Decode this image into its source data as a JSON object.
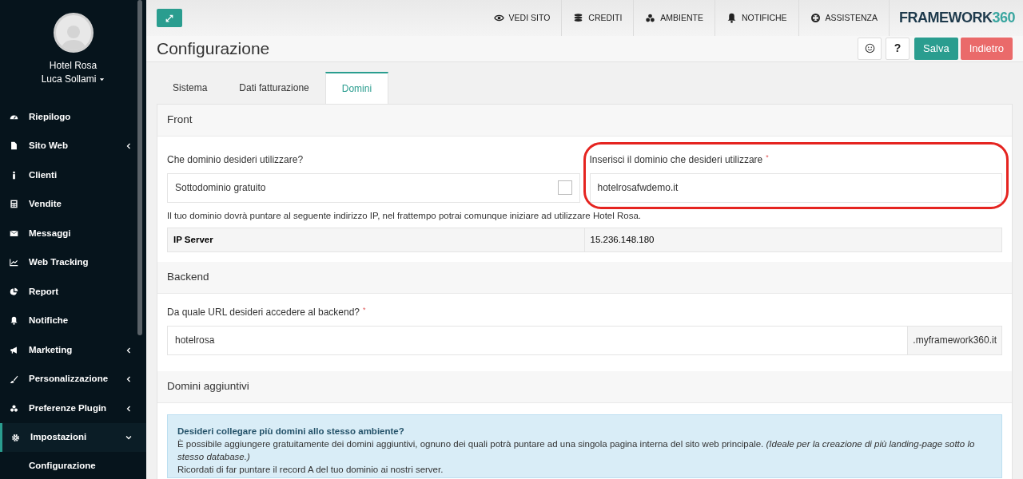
{
  "sidebar": {
    "hotel": "Hotel Rosa",
    "user": "Luca Sollami",
    "items": [
      {
        "label": "Riepilogo",
        "has_submenu": false,
        "expanded": false,
        "selected": false
      },
      {
        "label": "Sito Web",
        "has_submenu": true,
        "expanded": false,
        "selected": false
      },
      {
        "label": "Clienti",
        "has_submenu": false,
        "expanded": false,
        "selected": false
      },
      {
        "label": "Vendite",
        "has_submenu": false,
        "expanded": false,
        "selected": false
      },
      {
        "label": "Messaggi",
        "has_submenu": false,
        "expanded": false,
        "selected": false
      },
      {
        "label": "Web Tracking",
        "has_submenu": false,
        "expanded": false,
        "selected": false
      },
      {
        "label": "Report",
        "has_submenu": false,
        "expanded": false,
        "selected": false
      },
      {
        "label": "Notifiche",
        "has_submenu": false,
        "expanded": false,
        "selected": false
      },
      {
        "label": "Marketing",
        "has_submenu": true,
        "expanded": false,
        "selected": false
      },
      {
        "label": "Personalizzazione",
        "has_submenu": true,
        "expanded": false,
        "selected": false
      },
      {
        "label": "Preferenze Plugin",
        "has_submenu": true,
        "expanded": false,
        "selected": false
      },
      {
        "label": "Impostazioni",
        "has_submenu": true,
        "expanded": true,
        "selected": true,
        "children": [
          {
            "label": "Configurazione"
          }
        ]
      }
    ]
  },
  "topbar": {
    "links": [
      "VEDI SITO",
      "CREDITI",
      "AMBIENTE",
      "NOTIFICHE",
      "ASSISTENZA"
    ],
    "logo": "FRAMEWORK",
    "logo_number": "360"
  },
  "page": {
    "title": "Configurazione",
    "buttons": [
      {
        "label": "?",
        "kind": "help"
      },
      {
        "label": "Salva",
        "kind": "save"
      },
      {
        "label": "Indietro",
        "kind": "back"
      }
    ]
  },
  "tabs": [
    {
      "label": "Sistema",
      "selected": false
    },
    {
      "label": "Dati fatturazione",
      "selected": false
    },
    {
      "label": "Domini",
      "selected": true
    }
  ],
  "front": {
    "heading": "Front",
    "question": "Che dominio desideri utilizzare?",
    "subdomain_label": "Sottodominio gratuito",
    "subdomain_checked": false,
    "domain_label": "Inserisci il dominio che desideri utilizzare",
    "required_mark": "*",
    "domain_value": "hotelrosafwdemo.it",
    "highlighted": true,
    "note": "Il tuo dominio dovrà puntare al seguente indirizzo IP, nel frattempo potrai comunque iniziare ad utilizzare Hotel Rosa.",
    "ip_label": "IP Server",
    "ip_value": "15.236.148.180"
  },
  "backend": {
    "heading": "Backend",
    "question": "Da quale URL desideri accedere al backend?",
    "required_mark": "*",
    "value": "hotelrosa",
    "suffix": ".myframework360.it"
  },
  "extra": {
    "heading": "Domini aggiuntivi",
    "info_title": "Desideri collegare più domini allo stesso ambiente?",
    "info_text": "È possibile aggiungere gratuitamente dei domini aggiuntivi, ognuno dei quali potrà puntare ad una singola pagina interna del sito web principale. *(Ideale per la creazione di più landing-page sotto lo stesso database.)*",
    "info_text_2": "Ricordati di far puntare il record A del tuo dominio ai nostri server."
  }
}
